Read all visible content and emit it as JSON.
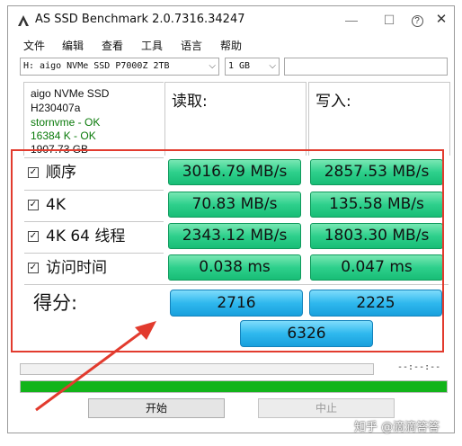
{
  "window": {
    "title": "AS SSD Benchmark 2.0.7316.34247",
    "help_glyph": "?",
    "min_glyph": "—",
    "max_glyph": "☐",
    "close_glyph": "✕"
  },
  "menu": [
    "文件",
    "编辑",
    "查看",
    "工具",
    "语言",
    "帮助"
  ],
  "drive_select": {
    "value": "H: aigo NVMe SSD P7000Z 2TB",
    "arrow": "⌵"
  },
  "size_select": {
    "value": "1 GB",
    "arrow": "⌵"
  },
  "info": {
    "model": "aigo NVMe SSD",
    "firmware": "H230407a",
    "driver": "stornvme - OK",
    "alignment": "16384 K - OK",
    "capacity": "1907.73 GB"
  },
  "columns": {
    "read": "读取:",
    "write": "写入:"
  },
  "rows": [
    {
      "label": "顺序",
      "checked": "☑",
      "read": "3016.79 MB/s",
      "write": "2857.53 MB/s"
    },
    {
      "label": "4K",
      "checked": "☑",
      "read": "70.83 MB/s",
      "write": "135.58 MB/s"
    },
    {
      "label": "4K 64 线程",
      "checked": "☑",
      "read": "2343.12 MB/s",
      "write": "1803.30 MB/s"
    },
    {
      "label": "访问时间",
      "checked": "☑",
      "read": "0.038 ms",
      "write": "0.047 ms"
    }
  ],
  "score": {
    "label": "得分:",
    "read": "2716",
    "write": "2225",
    "total": "6326"
  },
  "progress": {
    "time": "--:--:--",
    "main_fill_percent": 100,
    "accent": "#12b41a"
  },
  "buttons": {
    "start": "开始",
    "stop": "中止"
  },
  "watermark": "知乎 @滴滴答答",
  "highlight_color": "#e23b2e"
}
